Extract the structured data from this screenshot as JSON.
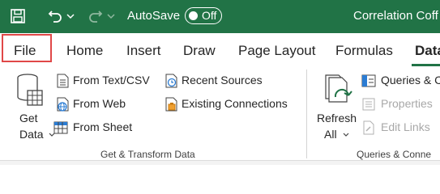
{
  "titlebar": {
    "save_icon": "save-icon",
    "undo_icon": "undo-icon",
    "redo_icon": "redo-icon",
    "autosave_label": "AutoSave",
    "autosave_state": "Off",
    "doc_title": "Correlation Coff"
  },
  "tabs": [
    "File",
    "Home",
    "Insert",
    "Draw",
    "Page Layout",
    "Formulas",
    "Data"
  ],
  "ribbon": {
    "get_data": {
      "line1": "Get",
      "line2": "Data"
    },
    "from_text_csv": "From Text/CSV",
    "from_web": "From Web",
    "from_sheet": "From Sheet",
    "recent_sources": "Recent Sources",
    "existing_connections": "Existing Connections",
    "group_get_transform": "Get & Transform Data",
    "refresh": {
      "line1": "Refresh",
      "line2": "All"
    },
    "queries": "Queries & C",
    "properties": "Properties",
    "edit_links": "Edit Links",
    "group_queries": "Queries & Conne"
  },
  "colors": {
    "titlebar": "#217346",
    "highlight": "#e04848",
    "accent": "#217346"
  }
}
